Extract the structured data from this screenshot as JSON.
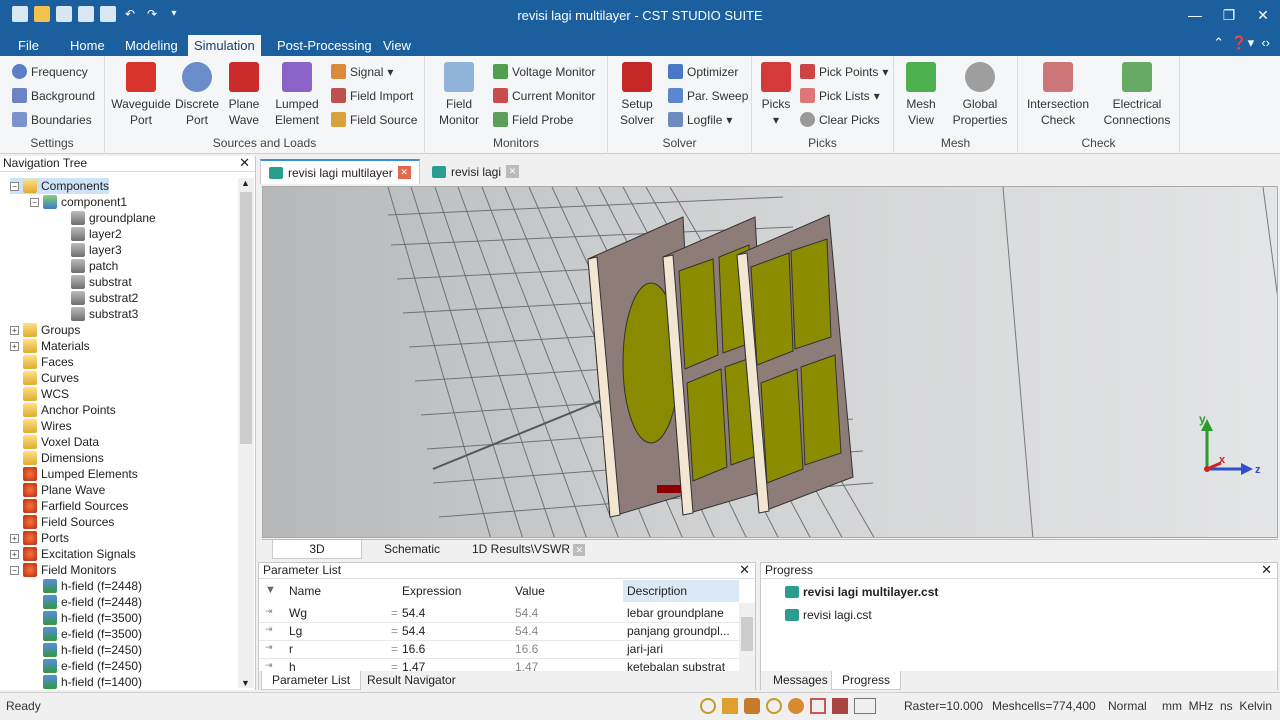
{
  "window": {
    "title": "revisi lagi multilayer - CST STUDIO SUITE"
  },
  "ribbon_tabs": [
    "File",
    "Home",
    "Modeling",
    "Simulation",
    "Post-Processing",
    "View"
  ],
  "ribbon": {
    "settings": {
      "label": "Settings",
      "items": [
        "Frequency",
        "Background",
        "Boundaries"
      ]
    },
    "sources": {
      "label": "Sources and Loads",
      "waveguide": "Waveguide\nPort",
      "discrete": "Discrete\nPort",
      "plane": "Plane\nWave",
      "lumped": "Lumped\nElement",
      "signal": "Signal",
      "field_import": "Field Import",
      "field_source": "Field Source"
    },
    "monitors": {
      "label": "Monitors",
      "field_monitor": "Field\nMonitor",
      "voltage": "Voltage Monitor",
      "current": "Current Monitor",
      "probe": "Field Probe"
    },
    "solver": {
      "label": "Solver",
      "setup": "Setup\nSolver",
      "optimizer": "Optimizer",
      "par_sweep": "Par. Sweep",
      "logfile": "Logfile"
    },
    "picks": {
      "label": "Picks",
      "picks": "Picks",
      "pick_points": "Pick Points",
      "pick_lists": "Pick Lists",
      "clear": "Clear Picks"
    },
    "mesh": {
      "label": "Mesh",
      "view": "Mesh\nView",
      "global": "Global\nProperties"
    },
    "check": {
      "label": "Check",
      "intersection": "Intersection\nCheck",
      "electrical": "Electrical\nConnections"
    }
  },
  "nav_tree": {
    "title": "Navigation Tree",
    "items": [
      {
        "label": "Components",
        "level": 0,
        "pm": "−",
        "icon": "folder"
      },
      {
        "label": "component1",
        "level": 1,
        "pm": "−",
        "icon": "comp"
      },
      {
        "label": "groundplane",
        "level": 2,
        "pm": "",
        "icon": "solid"
      },
      {
        "label": "layer2",
        "level": 2,
        "pm": "",
        "icon": "solid"
      },
      {
        "label": "layer3",
        "level": 2,
        "pm": "",
        "icon": "solid"
      },
      {
        "label": "patch",
        "level": 2,
        "pm": "",
        "icon": "solid"
      },
      {
        "label": "substrat",
        "level": 2,
        "pm": "",
        "icon": "solid"
      },
      {
        "label": "substrat2",
        "level": 2,
        "pm": "",
        "icon": "solid"
      },
      {
        "label": "substrat3",
        "level": 2,
        "pm": "",
        "icon": "solid"
      },
      {
        "label": "Groups",
        "level": 0,
        "pm": "+",
        "icon": "folder"
      },
      {
        "label": "Materials",
        "level": 0,
        "pm": "+",
        "icon": "folder"
      },
      {
        "label": "Faces",
        "level": 0,
        "pm": "",
        "icon": "folder"
      },
      {
        "label": "Curves",
        "level": 0,
        "pm": "",
        "icon": "folder"
      },
      {
        "label": "WCS",
        "level": 0,
        "pm": "",
        "icon": "folder"
      },
      {
        "label": "Anchor Points",
        "level": 0,
        "pm": "",
        "icon": "folder"
      },
      {
        "label": "Wires",
        "level": 0,
        "pm": "",
        "icon": "folder"
      },
      {
        "label": "Voxel Data",
        "level": 0,
        "pm": "",
        "icon": "folder"
      },
      {
        "label": "Dimensions",
        "level": 0,
        "pm": "",
        "icon": "folder"
      },
      {
        "label": "Lumped Elements",
        "level": 0,
        "pm": "",
        "icon": "redf"
      },
      {
        "label": "Plane Wave",
        "level": 0,
        "pm": "",
        "icon": "redf"
      },
      {
        "label": "Farfield Sources",
        "level": 0,
        "pm": "",
        "icon": "redf"
      },
      {
        "label": "Field Sources",
        "level": 0,
        "pm": "",
        "icon": "redf"
      },
      {
        "label": "Ports",
        "level": 0,
        "pm": "+",
        "icon": "redf"
      },
      {
        "label": "Excitation Signals",
        "level": 0,
        "pm": "+",
        "icon": "redf"
      },
      {
        "label": "Field Monitors",
        "level": 0,
        "pm": "−",
        "icon": "redf"
      },
      {
        "label": "h-field (f=2448)",
        "level": 1,
        "pm": "",
        "icon": "mon"
      },
      {
        "label": "e-field (f=2448)",
        "level": 1,
        "pm": "",
        "icon": "mon"
      },
      {
        "label": "h-field (f=3500)",
        "level": 1,
        "pm": "",
        "icon": "mon"
      },
      {
        "label": "e-field (f=3500)",
        "level": 1,
        "pm": "",
        "icon": "mon"
      },
      {
        "label": "h-field (f=2450)",
        "level": 1,
        "pm": "",
        "icon": "mon"
      },
      {
        "label": "e-field (f=2450)",
        "level": 1,
        "pm": "",
        "icon": "mon"
      },
      {
        "label": "h-field (f=1400)",
        "level": 1,
        "pm": "",
        "icon": "mon"
      }
    ]
  },
  "doc_tabs": [
    "revisi lagi multilayer",
    "revisi lagi"
  ],
  "view_tabs": [
    "3D",
    "Schematic",
    "1D Results\\VSWR"
  ],
  "axis_labels": {
    "y": "y",
    "x": "x",
    "z": "z"
  },
  "param_list": {
    "title": "Parameter List",
    "columns": [
      "Name",
      "Expression",
      "Value",
      "Description"
    ],
    "rows": [
      {
        "name": "Wg",
        "expr": "54.4",
        "value": "54.4",
        "desc": "lebar groundplane"
      },
      {
        "name": "Lg",
        "expr": "54.4",
        "value": "54.4",
        "desc": "panjang groundpl..."
      },
      {
        "name": "r",
        "expr": "16.6",
        "value": "16.6",
        "desc": "jari-jari"
      },
      {
        "name": "h",
        "expr": "1.47",
        "value": "1.47",
        "desc": "ketebalan substrat"
      }
    ],
    "tabs": [
      "Parameter List",
      "Result Navigator"
    ]
  },
  "progress": {
    "title": "Progress",
    "files": [
      "revisi lagi multilayer.cst",
      "revisi lagi.cst"
    ],
    "tabs": [
      "Messages",
      "Progress"
    ]
  },
  "status": {
    "left": "Ready",
    "raster": "Raster=10.000",
    "meshcells": "Meshcells=774,400",
    "mode": "Normal",
    "units": "mm  MHz  ns  Kelvin"
  }
}
